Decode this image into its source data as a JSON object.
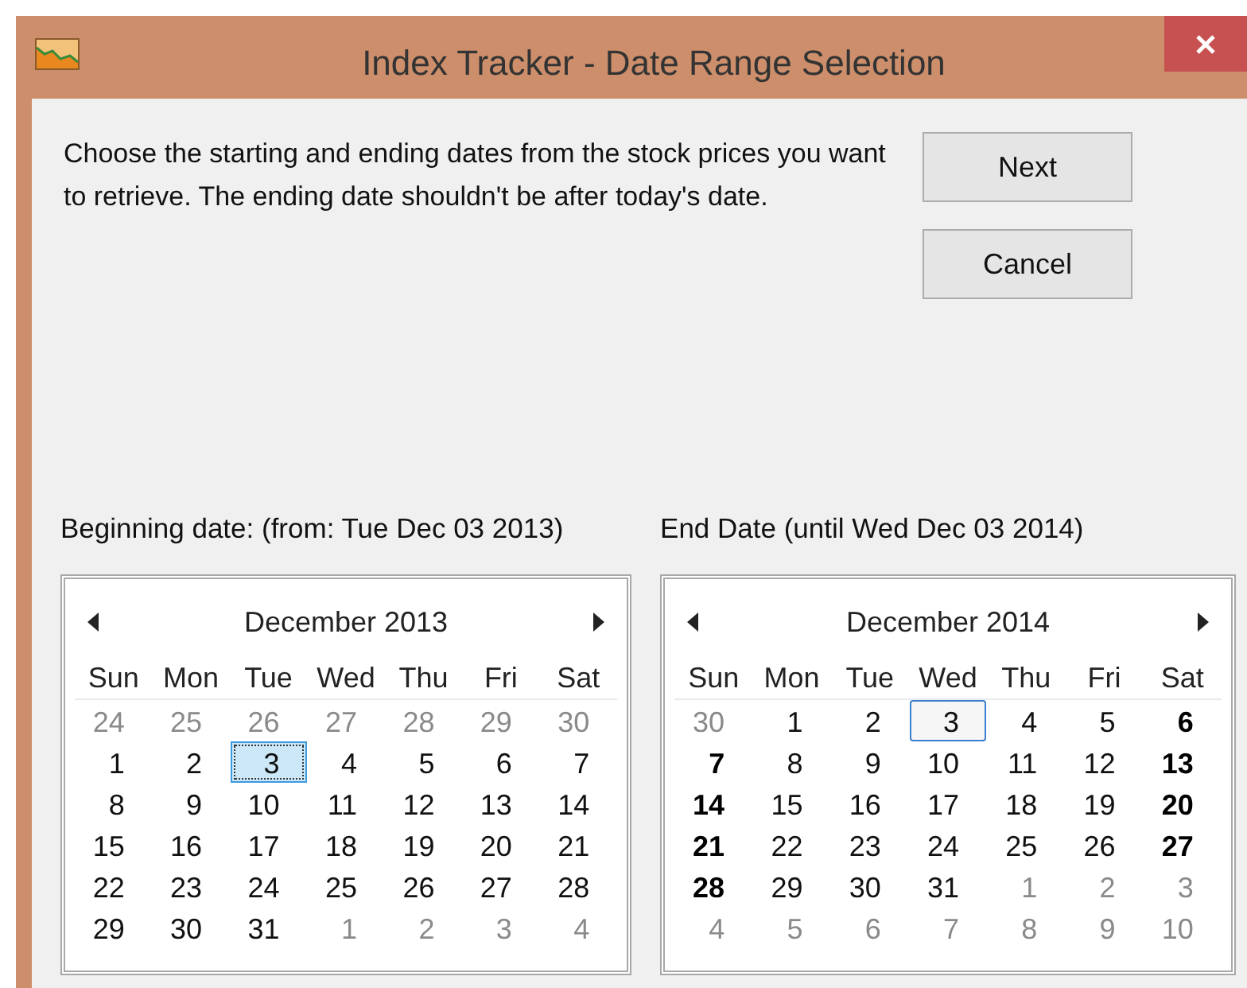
{
  "window": {
    "title": "Index Tracker - Date Range Selection"
  },
  "instructions": "Choose the starting and ending dates from the stock prices you want to retrieve. The ending date shouldn't be after today's date.",
  "buttons": [
    "Next",
    "Cancel"
  ],
  "calendars": [
    {
      "label": "Beginning date: (from: Tue Dec 03 2013)",
      "month": "December 2013",
      "weekdays": [
        "Sun",
        "Mon",
        "Tue",
        "Wed",
        "Thu",
        "Fri",
        "Sat"
      ],
      "weeks": [
        [
          {
            "d": "24",
            "kind": "other",
            "selected": false,
            "today": false
          },
          {
            "d": "25",
            "kind": "other",
            "selected": false,
            "today": false
          },
          {
            "d": "26",
            "kind": "other",
            "selected": false,
            "today": false
          },
          {
            "d": "27",
            "kind": "other",
            "selected": false,
            "today": false
          },
          {
            "d": "28",
            "kind": "other",
            "selected": false,
            "today": false
          },
          {
            "d": "29",
            "kind": "other",
            "selected": false,
            "today": false
          },
          {
            "d": "30",
            "kind": "other",
            "selected": false,
            "today": false
          }
        ],
        [
          {
            "d": "1",
            "kind": "normal",
            "selected": false,
            "today": false
          },
          {
            "d": "2",
            "kind": "normal",
            "selected": false,
            "today": false
          },
          {
            "d": "3",
            "kind": "normal",
            "selected": true,
            "today": false
          },
          {
            "d": "4",
            "kind": "normal",
            "selected": false,
            "today": false
          },
          {
            "d": "5",
            "kind": "normal",
            "selected": false,
            "today": false
          },
          {
            "d": "6",
            "kind": "normal",
            "selected": false,
            "today": false
          },
          {
            "d": "7",
            "kind": "normal",
            "selected": false,
            "today": false
          }
        ],
        [
          {
            "d": "8",
            "kind": "normal",
            "selected": false,
            "today": false
          },
          {
            "d": "9",
            "kind": "normal",
            "selected": false,
            "today": false
          },
          {
            "d": "10",
            "kind": "normal",
            "selected": false,
            "today": false
          },
          {
            "d": "11",
            "kind": "normal",
            "selected": false,
            "today": false
          },
          {
            "d": "12",
            "kind": "normal",
            "selected": false,
            "today": false
          },
          {
            "d": "13",
            "kind": "normal",
            "selected": false,
            "today": false
          },
          {
            "d": "14",
            "kind": "normal",
            "selected": false,
            "today": false
          }
        ],
        [
          {
            "d": "15",
            "kind": "normal",
            "selected": false,
            "today": false
          },
          {
            "d": "16",
            "kind": "normal",
            "selected": false,
            "today": false
          },
          {
            "d": "17",
            "kind": "normal",
            "selected": false,
            "today": false
          },
          {
            "d": "18",
            "kind": "normal",
            "selected": false,
            "today": false
          },
          {
            "d": "19",
            "kind": "normal",
            "selected": false,
            "today": false
          },
          {
            "d": "20",
            "kind": "normal",
            "selected": false,
            "today": false
          },
          {
            "d": "21",
            "kind": "normal",
            "selected": false,
            "today": false
          }
        ],
        [
          {
            "d": "22",
            "kind": "normal",
            "selected": false,
            "today": false
          },
          {
            "d": "23",
            "kind": "normal",
            "selected": false,
            "today": false
          },
          {
            "d": "24",
            "kind": "normal",
            "selected": false,
            "today": false
          },
          {
            "d": "25",
            "kind": "normal",
            "selected": false,
            "today": false
          },
          {
            "d": "26",
            "kind": "normal",
            "selected": false,
            "today": false
          },
          {
            "d": "27",
            "kind": "normal",
            "selected": false,
            "today": false
          },
          {
            "d": "28",
            "kind": "normal",
            "selected": false,
            "today": false
          }
        ],
        [
          {
            "d": "29",
            "kind": "normal",
            "selected": false,
            "today": false
          },
          {
            "d": "30",
            "kind": "normal",
            "selected": false,
            "today": false
          },
          {
            "d": "31",
            "kind": "normal",
            "selected": false,
            "today": false
          },
          {
            "d": "1",
            "kind": "other",
            "selected": false,
            "today": false
          },
          {
            "d": "2",
            "kind": "other",
            "selected": false,
            "today": false
          },
          {
            "d": "3",
            "kind": "other",
            "selected": false,
            "today": false
          },
          {
            "d": "4",
            "kind": "other",
            "selected": false,
            "today": false
          }
        ]
      ]
    },
    {
      "label": "End Date (until Wed Dec 03 2014)",
      "month": "December 2014",
      "weekdays": [
        "Sun",
        "Mon",
        "Tue",
        "Wed",
        "Thu",
        "Fri",
        "Sat"
      ],
      "weeks": [
        [
          {
            "d": "30",
            "kind": "other",
            "selected": false,
            "today": false
          },
          {
            "d": "1",
            "kind": "normal",
            "selected": false,
            "today": false
          },
          {
            "d": "2",
            "kind": "normal",
            "selected": false,
            "today": false
          },
          {
            "d": "3",
            "kind": "normal",
            "selected": false,
            "today": true
          },
          {
            "d": "4",
            "kind": "normal",
            "selected": false,
            "today": false
          },
          {
            "d": "5",
            "kind": "normal",
            "selected": false,
            "today": false
          },
          {
            "d": "6",
            "kind": "bold",
            "selected": false,
            "today": false
          }
        ],
        [
          {
            "d": "7",
            "kind": "bold",
            "selected": false,
            "today": false
          },
          {
            "d": "8",
            "kind": "normal",
            "selected": false,
            "today": false
          },
          {
            "d": "9",
            "kind": "normal",
            "selected": false,
            "today": false
          },
          {
            "d": "10",
            "kind": "normal",
            "selected": false,
            "today": false
          },
          {
            "d": "11",
            "kind": "normal",
            "selected": false,
            "today": false
          },
          {
            "d": "12",
            "kind": "normal",
            "selected": false,
            "today": false
          },
          {
            "d": "13",
            "kind": "bold",
            "selected": false,
            "today": false
          }
        ],
        [
          {
            "d": "14",
            "kind": "bold",
            "selected": false,
            "today": false
          },
          {
            "d": "15",
            "kind": "normal",
            "selected": false,
            "today": false
          },
          {
            "d": "16",
            "kind": "normal",
            "selected": false,
            "today": false
          },
          {
            "d": "17",
            "kind": "normal",
            "selected": false,
            "today": false
          },
          {
            "d": "18",
            "kind": "normal",
            "selected": false,
            "today": false
          },
          {
            "d": "19",
            "kind": "normal",
            "selected": false,
            "today": false
          },
          {
            "d": "20",
            "kind": "bold",
            "selected": false,
            "today": false
          }
        ],
        [
          {
            "d": "21",
            "kind": "bold",
            "selected": false,
            "today": false
          },
          {
            "d": "22",
            "kind": "normal",
            "selected": false,
            "today": false
          },
          {
            "d": "23",
            "kind": "normal",
            "selected": false,
            "today": false
          },
          {
            "d": "24",
            "kind": "normal",
            "selected": false,
            "today": false
          },
          {
            "d": "25",
            "kind": "normal",
            "selected": false,
            "today": false
          },
          {
            "d": "26",
            "kind": "normal",
            "selected": false,
            "today": false
          },
          {
            "d": "27",
            "kind": "bold",
            "selected": false,
            "today": false
          }
        ],
        [
          {
            "d": "28",
            "kind": "bold",
            "selected": false,
            "today": false
          },
          {
            "d": "29",
            "kind": "normal",
            "selected": false,
            "today": false
          },
          {
            "d": "30",
            "kind": "normal",
            "selected": false,
            "today": false
          },
          {
            "d": "31",
            "kind": "normal",
            "selected": false,
            "today": false
          },
          {
            "d": "1",
            "kind": "other",
            "selected": false,
            "today": false
          },
          {
            "d": "2",
            "kind": "other",
            "selected": false,
            "today": false
          },
          {
            "d": "3",
            "kind": "other",
            "selected": false,
            "today": false
          }
        ],
        [
          {
            "d": "4",
            "kind": "other",
            "selected": false,
            "today": false
          },
          {
            "d": "5",
            "kind": "other",
            "selected": false,
            "today": false
          },
          {
            "d": "6",
            "kind": "other",
            "selected": false,
            "today": false
          },
          {
            "d": "7",
            "kind": "other",
            "selected": false,
            "today": false
          },
          {
            "d": "8",
            "kind": "other",
            "selected": false,
            "today": false
          },
          {
            "d": "9",
            "kind": "other",
            "selected": false,
            "today": false
          },
          {
            "d": "10",
            "kind": "other",
            "selected": false,
            "today": false
          }
        ]
      ]
    }
  ]
}
